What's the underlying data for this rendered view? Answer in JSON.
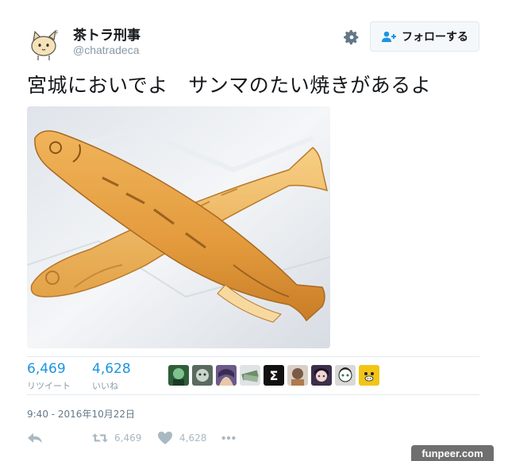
{
  "tweet": {
    "author": {
      "display_name": "茶トラ刑事",
      "handle": "@chatradeca",
      "avatar_icon": "cat-avatar-icon"
    },
    "header": {
      "settings_icon": "gear-icon",
      "follow_label": "フォローする",
      "follow_icon": "add-user-icon"
    },
    "text": "宮城においでよ　サンマのたい焼きがあるよ",
    "photo": {
      "subject_icon": "saury-taiyaki-icon"
    },
    "stats": {
      "retweets_count": "6,469",
      "retweets_label": "リツイート",
      "likes_count": "4,628",
      "likes_label": "いいね"
    },
    "likers": [
      {
        "icon": "liker-avatar-1",
        "color": "#2e5f3a"
      },
      {
        "icon": "liker-avatar-2",
        "color": "#5b6a5e"
      },
      {
        "icon": "liker-avatar-3",
        "color": "#6b5a8a"
      },
      {
        "icon": "liker-avatar-4",
        "color": "#dfe3e6"
      },
      {
        "icon": "liker-avatar-5",
        "color": "#111111",
        "glyph": "Σ"
      },
      {
        "icon": "liker-avatar-6",
        "color": "#7a5b48"
      },
      {
        "icon": "liker-avatar-7",
        "color": "#3b2f4a"
      },
      {
        "icon": "liker-avatar-8",
        "color": "#d9d9d9"
      },
      {
        "icon": "liker-avatar-9",
        "color": "#f2c515"
      }
    ],
    "timestamp": "9:40 - 2016年10月22日",
    "actions": {
      "reply_icon": "reply-icon",
      "retweet_icon": "retweet-icon",
      "retweet_count": "6,469",
      "like_icon": "heart-icon",
      "like_count": "4,628",
      "more_icon": "more-icon"
    }
  },
  "watermark": "funpeer.com",
  "colors": {
    "link_blue": "#1b95e0",
    "muted": "#8899a6",
    "action_gray": "#aab8c2"
  }
}
